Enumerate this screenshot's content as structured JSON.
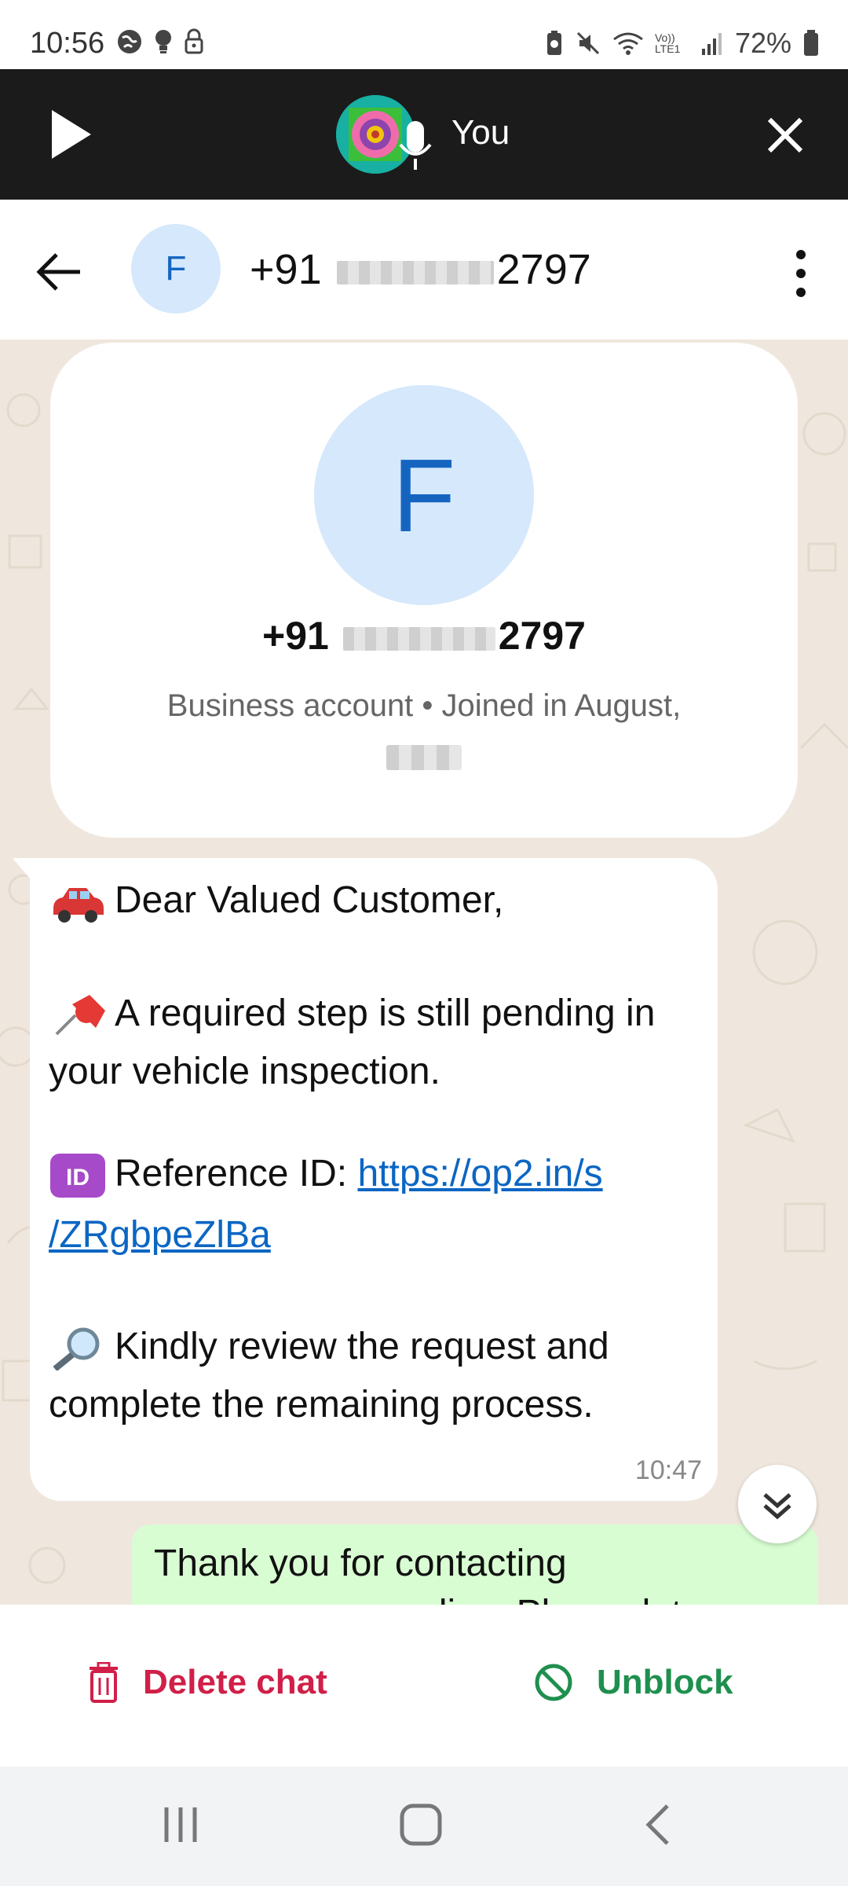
{
  "status_bar": {
    "time": "10:56",
    "battery": "72%",
    "network_label": "Vo)) LTE1"
  },
  "voice_bar": {
    "speaker_name": "You"
  },
  "header": {
    "avatar_letter": "F",
    "phone_prefix": "+91",
    "phone_suffix": "2797"
  },
  "profile_card": {
    "avatar_letter": "F",
    "phone_prefix": "+91",
    "phone_suffix": "2797",
    "subtitle": "Business account • Joined in August,"
  },
  "message_in": {
    "line1": "Dear Valued Customer,",
    "line2": "A required step is still pending in",
    "line3": "your vehicle inspection.",
    "line4_label": "Reference ID: ",
    "link_part1": "https://op2.in/s",
    "link_part2": "/ZRgbpeZlBa",
    "line5": "Kindly review the request and",
    "line6": "complete the remaining process.",
    "time": "10:47"
  },
  "message_out": {
    "line1": "Thank you for contacting",
    "line2": "resonance remedies. Please let us"
  },
  "bottom_actions": {
    "delete_label": "Delete chat",
    "unblock_label": "Unblock"
  },
  "colors": {
    "voice_bar_bg": "#1b1b1b",
    "chat_bg": "#efe7dd",
    "avatar_bg": "#d6e8fb",
    "avatar_fg": "#1565c0",
    "link": "#0b66c3",
    "delete": "#d01f48",
    "unblock": "#1f8f4e",
    "outgoing_bubble": "#d8fdd2"
  }
}
